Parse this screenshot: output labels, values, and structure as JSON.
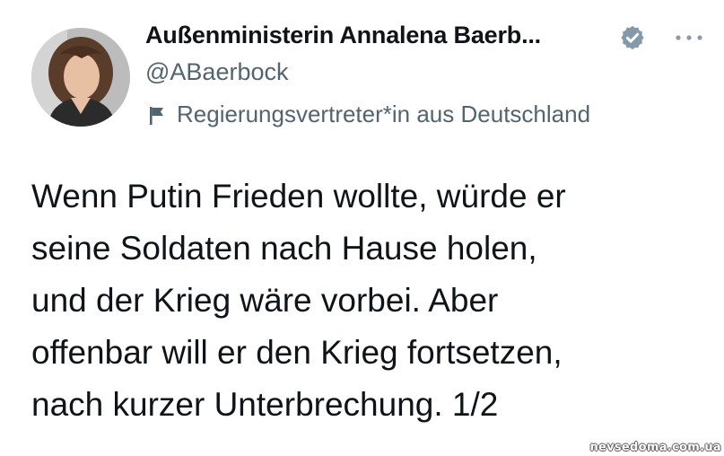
{
  "author": {
    "display_name": "Außenministerin Annalena Baerb...",
    "handle": "@ABaerbock",
    "verified": true,
    "affiliation": "Regierungsvertreter*in aus Deutschland"
  },
  "icons": {
    "avatar": "profile-photo",
    "verified": "verified-badge-icon",
    "more": "more-options-icon",
    "affiliation": "flag-icon"
  },
  "tweet": {
    "lines": [
      "Wenn Putin Frieden wollte, würde er",
      "seine Soldaten nach Hause holen,",
      "und der Krieg wäre vorbei. Aber",
      "offenbar will er den Krieg fortsetzen,",
      "nach kurzer Unterbrechung. 1/2"
    ]
  },
  "watermark": "nevsedoma.com.ua",
  "colors": {
    "text": "#0f1419",
    "secondary": "#536471",
    "verified_badge": "#829aab"
  }
}
